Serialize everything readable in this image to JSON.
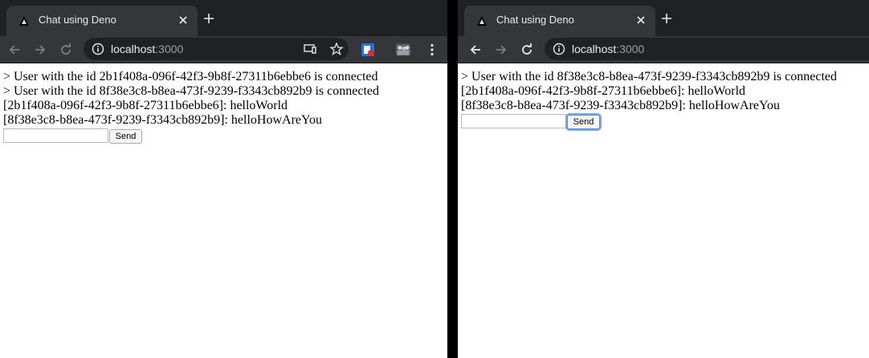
{
  "windows": [
    {
      "tab_title": "Chat using Deno",
      "url_host": "localhost",
      "url_port": ":3000",
      "messages": [
        "> User with the id 2b1f408a-096f-42f3-9b8f-27311b6ebbe6 is connected",
        "> User with the id 8f38e3c8-b8ea-473f-9239-f3343cb892b9 is connected",
        "[2b1f408a-096f-42f3-9b8f-27311b6ebbe6]: helloWorld",
        "[8f38e3c8-b8ea-473f-9239-f3343cb892b9]: helloHowAreYou"
      ],
      "input_value": "",
      "send_label": "Send"
    },
    {
      "tab_title": "Chat using Deno",
      "url_host": "localhost",
      "url_port": ":3000",
      "messages": [
        "> User with the id 8f38e3c8-b8ea-473f-9239-f3343cb892b9 is connected",
        "[2b1f408a-096f-42f3-9b8f-27311b6ebbe6]: helloWorld",
        "[8f38e3c8-b8ea-473f-9239-f3343cb892b9]: helloHowAreYou"
      ],
      "input_value": "",
      "send_label": "Send",
      "send_focused": true
    }
  ],
  "colors": {
    "tabstrip": "#202124",
    "toolbar": "#35363a",
    "focus_ring": "#7aa7ec"
  }
}
